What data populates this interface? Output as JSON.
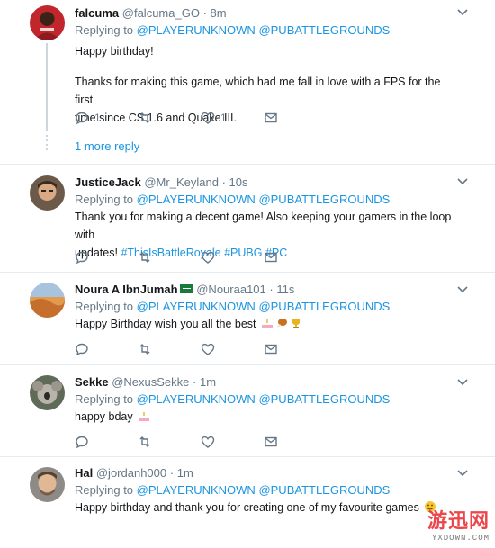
{
  "replying_label": "Replying to",
  "mentions": [
    "@PLAYERUNKNOWN",
    "@PUBATTLEGROUNDS"
  ],
  "tweets": [
    {
      "name": "falcuma",
      "handle": "@falcuma_GO",
      "time": "8m",
      "text_lines": [
        "Happy birthday!",
        "",
        "Thanks for making this game, which had me fall in love with a FPS for the first",
        "time since CS 1.6 and Quake III."
      ],
      "reply_count": "1",
      "like_count": "1",
      "more_replies": "1 more reply"
    },
    {
      "name": "JusticeJack",
      "handle": "@Mr_Keyland",
      "time": "10s",
      "text_line1": "Thank you for making a decent game! Also keeping your gamers in the loop with",
      "text_line2_prefix": "updates!",
      "hashtags": [
        "#ThisIsBattleRoyale",
        "#PUBG",
        "#PC"
      ]
    },
    {
      "name": "Noura A IbnJumah",
      "handle": "@Nouraa101",
      "time": "11s",
      "text": "Happy Birthday wish you all the best",
      "emojis": [
        "cake-emoji",
        "drumstick-emoji",
        "trophy-emoji"
      ]
    },
    {
      "name": "Sekke",
      "handle": "@NexusSekke",
      "time": "1m",
      "text": "happy bday",
      "emojis": [
        "cake-emoji"
      ]
    },
    {
      "name": "Hal",
      "handle": "@jordanh000",
      "time": "1m",
      "text": "Happy birthday and thank you for creating one of my favourite games",
      "emojis": [
        "smile-emoji"
      ]
    }
  ],
  "watermark": {
    "logo": "游迅网",
    "url": "YXDOWN.COM"
  },
  "colors": {
    "link": "#1b95e0",
    "secondary": "#657786",
    "border": "#e6ecf0"
  }
}
